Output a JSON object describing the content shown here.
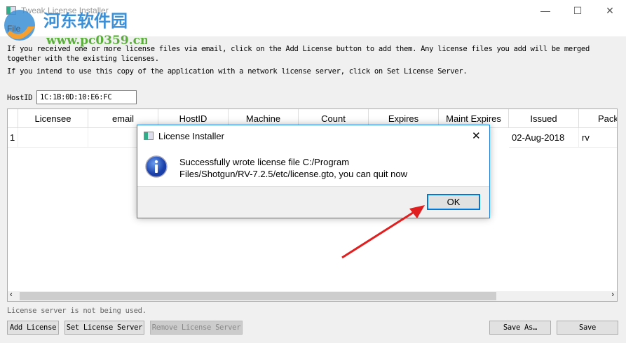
{
  "window": {
    "title": "Tweak License Installer",
    "menu": [
      "File"
    ]
  },
  "watermark": {
    "name": "河东软件园",
    "url": "www.pc0359.cn"
  },
  "info": {
    "line1": "If you received one or more license files via email, click on the Add License button to add them. Any license files you add will be merged",
    "line2": "together with the existing licenses.",
    "line3": "If you intend to use this copy of the application with a network license server, click on Set License Server."
  },
  "hostid": {
    "label": "HostID",
    "value": "1C:1B:0D:10:E6:FC"
  },
  "table": {
    "columns": [
      "Licensee",
      "email",
      "HostID",
      "Machine",
      "Count",
      "Expires",
      "Maint Expires",
      "Issued",
      "Packa"
    ],
    "rows": [
      {
        "num": "1",
        "cells": [
          "",
          "",
          "",
          "",
          "",
          "",
          "",
          "02-Aug-2018",
          "rv"
        ]
      }
    ]
  },
  "status": "License server is not being used.",
  "buttons": {
    "add": "Add License",
    "set": "Set License Server",
    "remove": "Remove License Server",
    "saveas": "Save As…",
    "save": "Save"
  },
  "dialog": {
    "title": "License Installer",
    "line1": "Successfully wrote license file C:/Program",
    "line2": "Files/Shotgun/RV-7.2.5/etc/license.gto, you can quit now",
    "ok": "OK",
    "close": "✕"
  },
  "colors": {
    "accent": "#0078d7",
    "arrow": "#e02020"
  }
}
